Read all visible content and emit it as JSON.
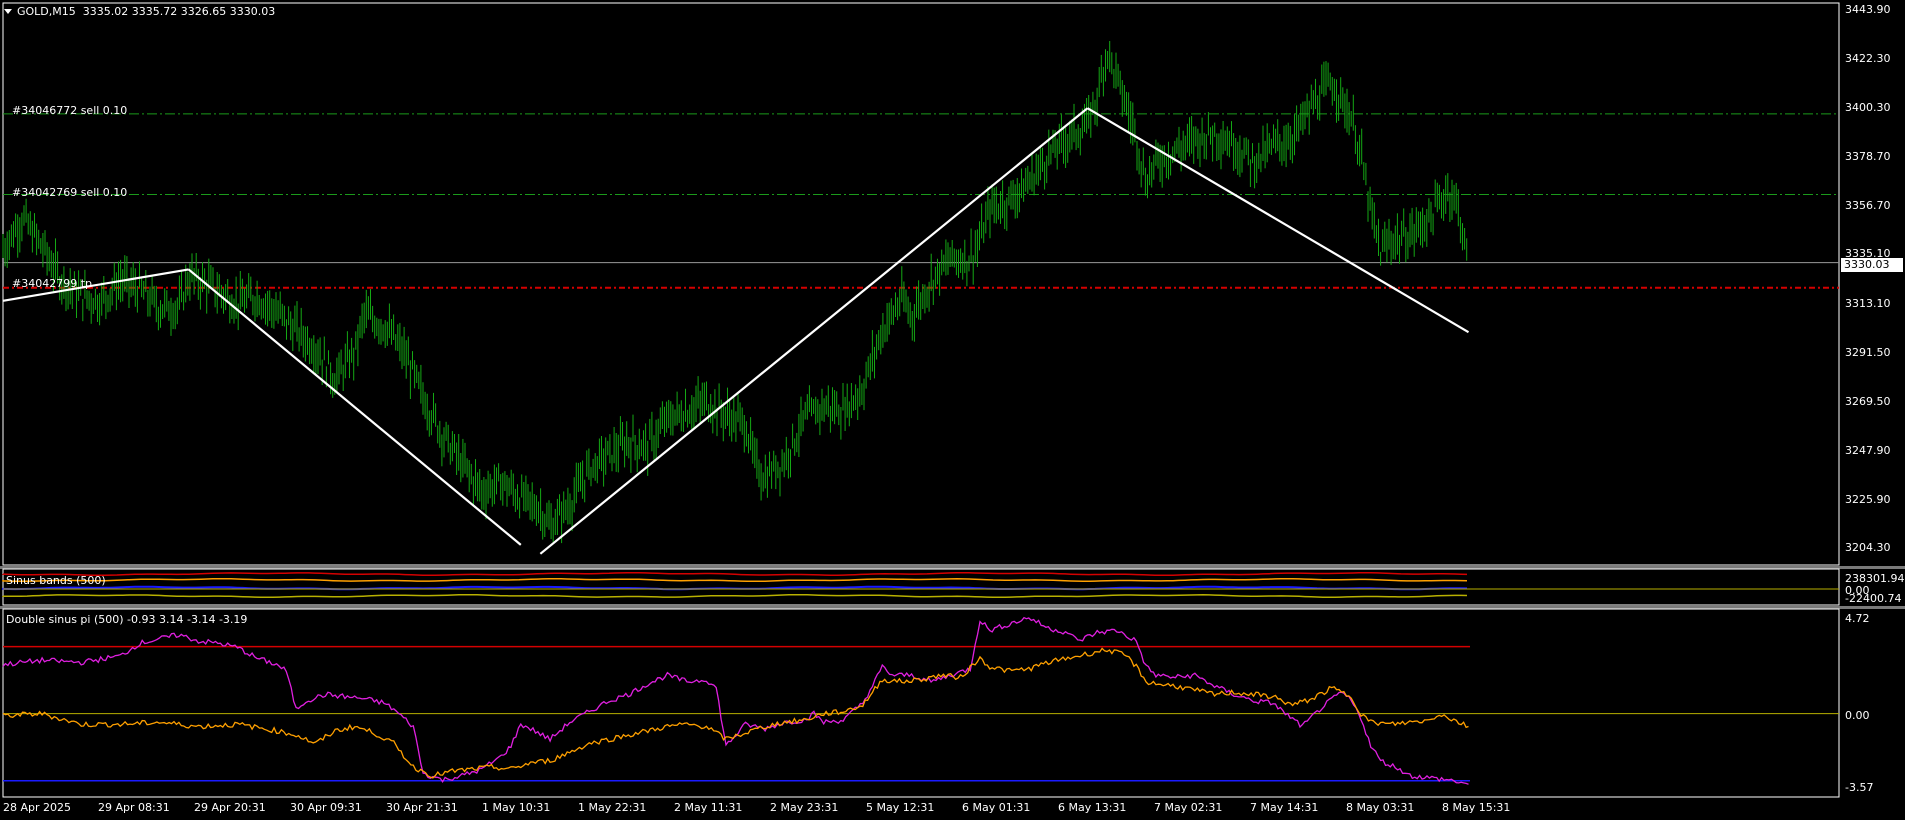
{
  "header": {
    "symbol": "GOLD,M15",
    "ohlc": "3335.02 3335.72 3326.65 3330.03"
  },
  "orders": [
    {
      "label": "#34046772 sell 0.10",
      "price": 3396.5,
      "color": "#1b9a1b"
    },
    {
      "label": "#34042769 sell 0.10",
      "price": 3360.5,
      "color": "#1b9a1b"
    },
    {
      "label": "#34042799 tp",
      "price": 3318.8,
      "color": "#d40000"
    }
  ],
  "current_price": "3330.03",
  "price_axis": [
    "3443.90",
    "3422.30",
    "3400.30",
    "3378.70",
    "3356.70",
    "3335.10",
    "3313.10",
    "3291.50",
    "3269.50",
    "3247.90",
    "3225.90",
    "3204.30"
  ],
  "time_axis": [
    "28 Apr 2025",
    "29 Apr 08:31",
    "29 Apr 20:31",
    "30 Apr 09:31",
    "30 Apr 21:31",
    "1 May 10:31",
    "1 May 22:31",
    "2 May 11:31",
    "2 May 23:31",
    "5 May 12:31",
    "6 May 01:31",
    "6 May 13:31",
    "7 May 02:31",
    "7 May 14:31",
    "8 May 03:31",
    "8 May 15:31"
  ],
  "sinus_bands": {
    "title": "Sinus bands (500)",
    "axis": [
      "238301.94",
      "0.00",
      "-22400.74"
    ]
  },
  "double_sinus": {
    "title": "Double sinus pi (500) -0.93 3.14 -3.14 -3.19",
    "axis": [
      "4.72",
      "0.00",
      "-3.57"
    ],
    "level_top": 3.14,
    "level_bottom": -3.14
  },
  "colors": {
    "candles": "#14a814",
    "trendline": "#ffffff",
    "magenta": "#e020e0",
    "orange": "#ffa000",
    "band_red": "#d40000",
    "band_blue": "#1a1aff",
    "band_yellow": "#b8b000"
  },
  "chart_data": {
    "type": "line",
    "title": "GOLD,M15",
    "ylim": [
      3195,
      3446
    ],
    "price_path": [
      [
        0,
        3336
      ],
      [
        2,
        3350
      ],
      [
        4,
        3337
      ],
      [
        6,
        3322
      ],
      [
        8,
        3315
      ],
      [
        10,
        3313
      ],
      [
        12,
        3322
      ],
      [
        14,
        3318
      ],
      [
        16,
        3310
      ],
      [
        18,
        3310
      ],
      [
        19,
        3324
      ],
      [
        21,
        3320
      ],
      [
        24,
        3312
      ],
      [
        26,
        3315
      ],
      [
        28,
        3308
      ],
      [
        30,
        3300
      ],
      [
        32,
        3292
      ],
      [
        34,
        3278
      ],
      [
        36,
        3290
      ],
      [
        37,
        3307
      ],
      [
        39,
        3302
      ],
      [
        41,
        3290
      ],
      [
        43,
        3270
      ],
      [
        45,
        3253
      ],
      [
        47,
        3240
      ],
      [
        49,
        3228
      ],
      [
        51,
        3232
      ],
      [
        53,
        3225
      ],
      [
        55,
        3220
      ],
      [
        56,
        3212
      ],
      [
        58,
        3222
      ],
      [
        60,
        3238
      ],
      [
        62,
        3244
      ],
      [
        64,
        3250
      ],
      [
        66,
        3248
      ],
      [
        68,
        3260
      ],
      [
        70,
        3264
      ],
      [
        72,
        3268
      ],
      [
        74,
        3262
      ],
      [
        76,
        3258
      ],
      [
        77,
        3240
      ],
      [
        78,
        3234
      ],
      [
        80,
        3242
      ],
      [
        82,
        3260
      ],
      [
        84,
        3266
      ],
      [
        86,
        3264
      ],
      [
        88,
        3274
      ],
      [
        90,
        3300
      ],
      [
        92,
        3314
      ],
      [
        93,
        3306
      ],
      [
        95,
        3322
      ],
      [
        97,
        3332
      ],
      [
        99,
        3332
      ],
      [
        100,
        3340
      ],
      [
        101,
        3354
      ],
      [
        103,
        3358
      ],
      [
        105,
        3366
      ],
      [
        107,
        3378
      ],
      [
        109,
        3386
      ],
      [
        111,
        3392
      ],
      [
        112,
        3404
      ],
      [
        113,
        3425
      ],
      [
        115,
        3400
      ],
      [
        116,
        3386
      ],
      [
        117,
        3366
      ],
      [
        118,
        3375
      ],
      [
        120,
        3380
      ],
      [
        122,
        3385
      ],
      [
        124,
        3388
      ],
      [
        126,
        3383
      ],
      [
        128,
        3375
      ],
      [
        130,
        3382
      ],
      [
        132,
        3386
      ],
      [
        134,
        3400
      ],
      [
        136,
        3411
      ],
      [
        138,
        3395
      ],
      [
        139,
        3378
      ],
      [
        140,
        3352
      ],
      [
        141,
        3335
      ],
      [
        142,
        3340
      ],
      [
        144,
        3342
      ],
      [
        146,
        3350
      ],
      [
        148,
        3363
      ],
      [
        149,
        3354
      ],
      [
        150,
        3328
      ]
    ],
    "trend_lines": [
      [
        [
          0,
          3313
        ],
        [
          19,
          3327
        ]
      ],
      [
        [
          19,
          3327
        ],
        [
          53,
          3204
        ]
      ],
      [
        [
          55,
          3200
        ],
        [
          111,
          3399
        ]
      ],
      [
        [
          111,
          3399
        ],
        [
          150,
          3299
        ]
      ]
    ],
    "sinus_bands_lines": [
      "red",
      "orange",
      "blue",
      "yellow"
    ],
    "double_sinus": {
      "ylim": [
        -3.9,
        4.9
      ],
      "levels": [
        3.14,
        0.0,
        -3.14
      ],
      "series": [
        {
          "color": "magenta",
          "values": [
            [
              0,
              2.3
            ],
            [
              4,
              2.5
            ],
            [
              8,
              2.4
            ],
            [
              12,
              2.7
            ],
            [
              14,
              3.3
            ],
            [
              16,
              3.5
            ],
            [
              18,
              3.7
            ],
            [
              20,
              3.4
            ],
            [
              22,
              3.3
            ],
            [
              24,
              3.1
            ],
            [
              26,
              2.6
            ],
            [
              28,
              2.3
            ],
            [
              29,
              2.0
            ],
            [
              30,
              0.2
            ],
            [
              31,
              0.6
            ],
            [
              33,
              0.9
            ],
            [
              35,
              0.8
            ],
            [
              37,
              0.7
            ],
            [
              39,
              0.5
            ],
            [
              40,
              0.2
            ],
            [
              42,
              -0.6
            ],
            [
              43,
              -2.8
            ],
            [
              45,
              -3.1
            ],
            [
              47,
              -2.9
            ],
            [
              49,
              -2.6
            ],
            [
              51,
              -2.0
            ],
            [
              52,
              -1.5
            ],
            [
              53,
              -0.5
            ],
            [
              54,
              -0.7
            ],
            [
              56,
              -1.2
            ],
            [
              58,
              -0.4
            ],
            [
              60,
              0.1
            ],
            [
              62,
              0.6
            ],
            [
              64,
              0.9
            ],
            [
              66,
              1.4
            ],
            [
              68,
              1.8
            ],
            [
              70,
              1.5
            ],
            [
              72,
              1.6
            ],
            [
              73,
              1.2
            ],
            [
              74,
              -1.5
            ],
            [
              75,
              -1.0
            ],
            [
              76,
              -0.5
            ],
            [
              78,
              -0.7
            ],
            [
              80,
              -0.4
            ],
            [
              82,
              -0.3
            ],
            [
              83,
              0.0
            ],
            [
              84,
              -0.4
            ],
            [
              86,
              -0.3
            ],
            [
              88,
              0.5
            ],
            [
              89,
              1.3
            ],
            [
              90,
              2.2
            ],
            [
              91,
              1.8
            ],
            [
              93,
              1.8
            ],
            [
              95,
              1.5
            ],
            [
              97,
              1.8
            ],
            [
              99,
              2.1
            ],
            [
              100,
              4.4
            ],
            [
              101,
              3.9
            ],
            [
              103,
              4.2
            ],
            [
              105,
              4.5
            ],
            [
              107,
              4.0
            ],
            [
              109,
              3.8
            ],
            [
              110,
              3.4
            ],
            [
              112,
              3.8
            ],
            [
              114,
              3.9
            ],
            [
              116,
              3.4
            ],
            [
              117,
              2.2
            ],
            [
              118,
              1.8
            ],
            [
              120,
              1.7
            ],
            [
              122,
              1.8
            ],
            [
              124,
              1.3
            ],
            [
              126,
              0.9
            ],
            [
              128,
              0.6
            ],
            [
              130,
              0.5
            ],
            [
              131,
              0.1
            ],
            [
              133,
              -0.6
            ],
            [
              135,
              0.3
            ],
            [
              137,
              1.0
            ],
            [
              138,
              0.6
            ],
            [
              139,
              -0.2
            ],
            [
              140,
              -1.5
            ],
            [
              141,
              -2.2
            ],
            [
              143,
              -2.6
            ],
            [
              144,
              -2.9
            ],
            [
              146,
              -3.0
            ],
            [
              148,
              -3.1
            ],
            [
              150,
              -3.3
            ]
          ]
        },
        {
          "color": "orange",
          "values": [
            [
              0,
              -0.1
            ],
            [
              4,
              0.0
            ],
            [
              8,
              -0.5
            ],
            [
              12,
              -0.5
            ],
            [
              16,
              -0.4
            ],
            [
              18,
              -0.5
            ],
            [
              20,
              -0.6
            ],
            [
              24,
              -0.5
            ],
            [
              28,
              -0.8
            ],
            [
              30,
              -1.0
            ],
            [
              32,
              -1.4
            ],
            [
              34,
              -0.8
            ],
            [
              36,
              -0.6
            ],
            [
              38,
              -0.9
            ],
            [
              40,
              -1.4
            ],
            [
              42,
              -2.5
            ],
            [
              44,
              -2.9
            ],
            [
              46,
              -2.7
            ],
            [
              48,
              -2.6
            ],
            [
              50,
              -2.5
            ],
            [
              52,
              -2.6
            ],
            [
              54,
              -2.3
            ],
            [
              56,
              -2.2
            ],
            [
              58,
              -1.8
            ],
            [
              60,
              -1.4
            ],
            [
              62,
              -1.2
            ],
            [
              64,
              -1.0
            ],
            [
              66,
              -0.8
            ],
            [
              68,
              -0.6
            ],
            [
              70,
              -0.5
            ],
            [
              72,
              -0.6
            ],
            [
              74,
              -1.2
            ],
            [
              76,
              -0.9
            ],
            [
              78,
              -0.6
            ],
            [
              80,
              -0.4
            ],
            [
              82,
              -0.3
            ],
            [
              84,
              0.0
            ],
            [
              86,
              0.1
            ],
            [
              88,
              0.4
            ],
            [
              89,
              1.0
            ],
            [
              90,
              1.6
            ],
            [
              92,
              1.5
            ],
            [
              94,
              1.6
            ],
            [
              96,
              1.8
            ],
            [
              98,
              1.7
            ],
            [
              100,
              2.6
            ],
            [
              101,
              2.2
            ],
            [
              103,
              2.0
            ],
            [
              105,
              2.1
            ],
            [
              107,
              2.4
            ],
            [
              109,
              2.6
            ],
            [
              111,
              2.8
            ],
            [
              113,
              3.0
            ],
            [
              115,
              2.7
            ],
            [
              116,
              2.2
            ],
            [
              117,
              1.5
            ],
            [
              118,
              1.4
            ],
            [
              120,
              1.3
            ],
            [
              122,
              1.1
            ],
            [
              124,
              0.9
            ],
            [
              126,
              1.0
            ],
            [
              128,
              0.9
            ],
            [
              130,
              0.8
            ],
            [
              132,
              0.4
            ],
            [
              134,
              0.7
            ],
            [
              136,
              1.2
            ],
            [
              138,
              0.8
            ],
            [
              139,
              0.0
            ],
            [
              140,
              -0.4
            ],
            [
              142,
              -0.5
            ],
            [
              144,
              -0.4
            ],
            [
              146,
              -0.3
            ],
            [
              147,
              0.0
            ],
            [
              148,
              -0.2
            ],
            [
              150,
              -0.6
            ]
          ]
        }
      ]
    }
  }
}
